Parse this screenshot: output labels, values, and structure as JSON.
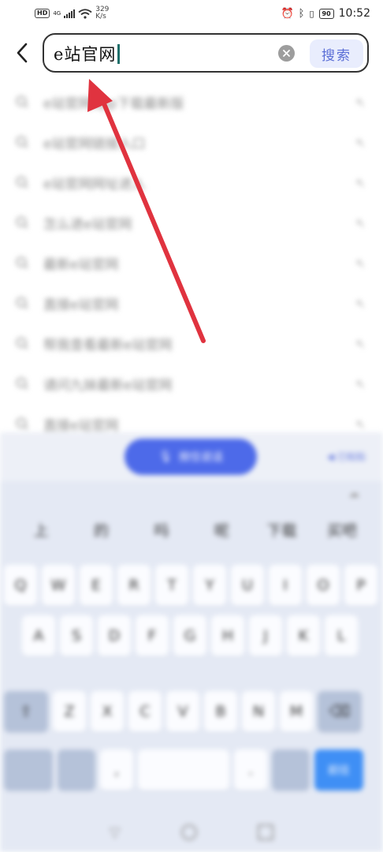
{
  "status_bar": {
    "hd_badge": "HD",
    "network": "4G",
    "speed_value": "329",
    "speed_unit": "K/s",
    "battery": "90",
    "time": "10:52"
  },
  "search": {
    "query": "e站官网",
    "button_label": "搜索"
  },
  "suggestions": [
    "e站官网app下载最新版",
    "e站官网链接入口",
    "e站官网网址进入",
    "怎么进e站官网",
    "最新e站官网",
    "直接e站官网",
    "帮我查看最新e站官网",
    "请问九妹最新e站官网",
    "直接e站官网"
  ],
  "keyboard": {
    "voice_label": "按住说话",
    "toolbar_right": "◀ 已粘贴",
    "candidates": [
      "上",
      "的",
      "吗",
      "呢",
      "下载",
      "买吧"
    ],
    "row1": [
      "Q",
      "W",
      "E",
      "R",
      "T",
      "Y",
      "U",
      "I",
      "O",
      "P"
    ],
    "row2": [
      "A",
      "S",
      "D",
      "F",
      "G",
      "H",
      "J",
      "K",
      "L"
    ],
    "row3": [
      "Z",
      "X",
      "C",
      "V",
      "B",
      "N",
      "M"
    ],
    "bottom": {
      "left1": "",
      "left2": "",
      "comma": ",",
      "space": "",
      "period": ".",
      "mode": "",
      "action": "前往"
    }
  },
  "colors": {
    "accent": "#4d6ae9",
    "arrow": "#e0333f",
    "search_btn_text": "#5a6ed6",
    "caret": "#1f6f6a"
  }
}
